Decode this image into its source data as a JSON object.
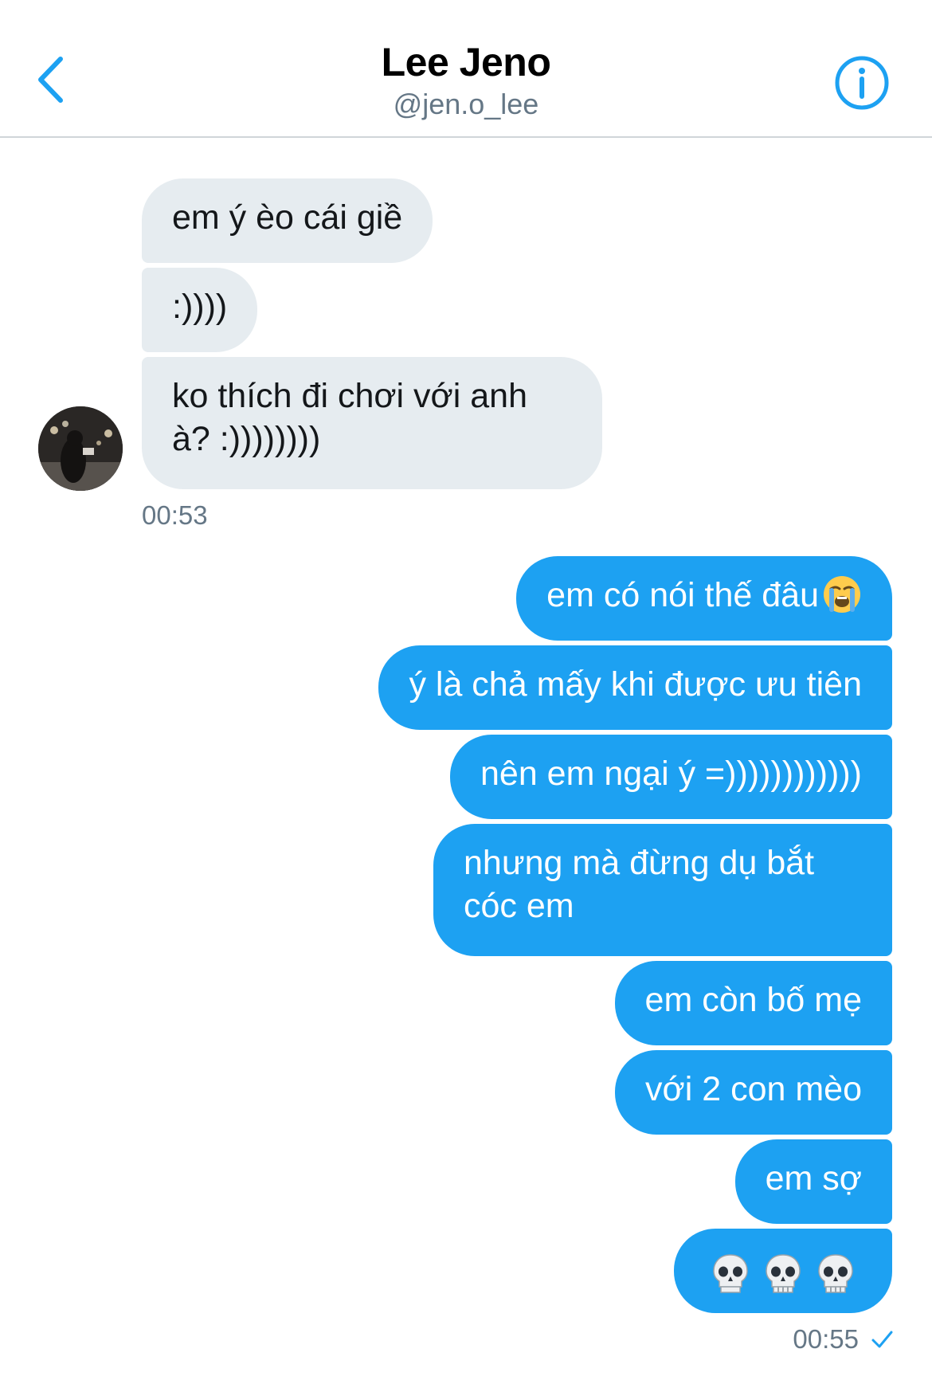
{
  "header": {
    "name": "Lee Jeno",
    "handle": "@jen.o_lee"
  },
  "received_messages": [
    "em ý èo cái giề",
    ":))))",
    "ko thích đi chơi với anh",
    "à? :))))))))"
  ],
  "received_time": "00:53",
  "sent_messages": {
    "m1": "em có nói thế đâu",
    "m2": "ý là chả mấy khi được ưu tiên",
    "m3": "nên em ngại ý =))))))))))))",
    "m4_line1": "nhưng mà đừng dụ bắt",
    "m4_line2": "cóc em",
    "m5": "em còn bố mẹ",
    "m6": "với 2 con mèo",
    "m7": "em sợ"
  },
  "sent_time": "00:55",
  "colors": {
    "accent": "#1da1f2",
    "received_bubble": "#e6ecf0",
    "muted_text": "#657786"
  },
  "icons": {
    "back": "chevron-left-icon",
    "info": "info-icon",
    "crying": "loudly-crying-face-emoji",
    "skull": "skull-emoji",
    "read": "checkmark-icon"
  }
}
